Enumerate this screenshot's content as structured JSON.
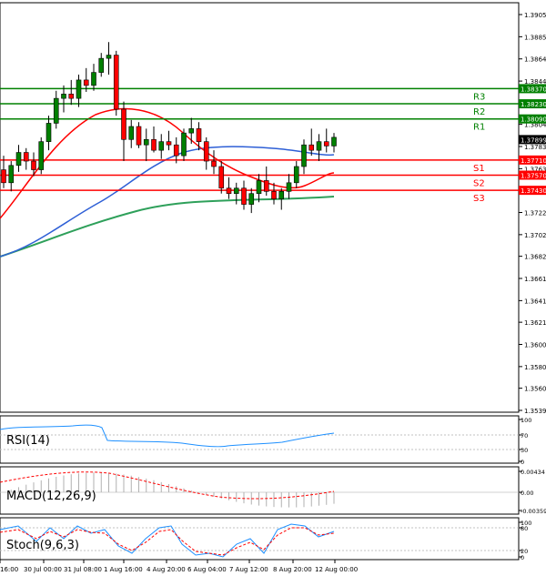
{
  "chart_data": {
    "type": "line",
    "price_axis": {
      "ticks": [
        "1.39055",
        "1.38850",
        "1.38645",
        "1.38440",
        "1.38230",
        "1.38040",
        "1.37835",
        "1.37630",
        "1.37225",
        "1.37020",
        "1.36820",
        "1.36615",
        "1.36410",
        "1.36210",
        "1.36005",
        "1.35800",
        "1.35600",
        "1.35395"
      ]
    },
    "levels": [
      {
        "label": "R3",
        "value": 1.3837,
        "price_text": "1.38370",
        "color": "#008000"
      },
      {
        "label": "R2",
        "value": 1.3823,
        "price_text": "1.38230",
        "color": "#008000"
      },
      {
        "label": "R1",
        "value": 1.3809,
        "price_text": "1.38090",
        "color": "#008000"
      },
      {
        "label": "S1",
        "value": 1.3771,
        "price_text": "1.37710",
        "color": "#ff0000"
      },
      {
        "label": "S2",
        "value": 1.3757,
        "price_text": "1.37570",
        "color": "#ff0000"
      },
      {
        "label": "S3",
        "value": 1.3743,
        "price_text": "1.37430",
        "color": "#ff0000"
      }
    ],
    "current_price": {
      "value": 1.37899,
      "text": "1.37899"
    },
    "x_axis": {
      "ticks": [
        "16:00",
        "30 Jul 00:00",
        "31 Jul 08:00",
        "1 Aug 16:00",
        "4 Aug 20:00",
        "6 Aug 04:00",
        "7 Aug 12:00",
        "8 Aug 20:00",
        "12 Aug 00:00"
      ]
    },
    "candles": [
      [
        1.3762,
        1.3775,
        1.3745,
        1.375
      ],
      [
        1.375,
        1.377,
        1.3742,
        1.3766
      ],
      [
        1.3766,
        1.3785,
        1.376,
        1.3778
      ],
      [
        1.3778,
        1.3782,
        1.3762,
        1.377
      ],
      [
        1.377,
        1.3778,
        1.3756,
        1.3762
      ],
      [
        1.3762,
        1.3792,
        1.3758,
        1.3788
      ],
      [
        1.3788,
        1.3812,
        1.378,
        1.3805
      ],
      [
        1.3805,
        1.3835,
        1.38,
        1.3828
      ],
      [
        1.3828,
        1.384,
        1.3815,
        1.3832
      ],
      [
        1.3832,
        1.3845,
        1.3822,
        1.3828
      ],
      [
        1.3828,
        1.385,
        1.382,
        1.3845
      ],
      [
        1.3845,
        1.3856,
        1.3834,
        1.384
      ],
      [
        1.384,
        1.386,
        1.3835,
        1.3852
      ],
      [
        1.3852,
        1.387,
        1.3848,
        1.3865
      ],
      [
        1.3865,
        1.388,
        1.385,
        1.3868
      ],
      [
        1.3868,
        1.3872,
        1.3812,
        1.3818
      ],
      [
        1.3818,
        1.3825,
        1.377,
        1.379
      ],
      [
        1.379,
        1.3808,
        1.3782,
        1.3802
      ],
      [
        1.3802,
        1.3806,
        1.3782,
        1.3785
      ],
      [
        1.3785,
        1.38,
        1.377,
        1.379
      ],
      [
        1.379,
        1.3802,
        1.3778,
        1.378
      ],
      [
        1.378,
        1.3795,
        1.3772,
        1.3788
      ],
      [
        1.3788,
        1.3798,
        1.378,
        1.3785
      ],
      [
        1.3785,
        1.3792,
        1.3768,
        1.3775
      ],
      [
        1.3775,
        1.38,
        1.377,
        1.3796
      ],
      [
        1.3796,
        1.381,
        1.3786,
        1.38
      ],
      [
        1.38,
        1.3806,
        1.378,
        1.3788
      ],
      [
        1.3788,
        1.3792,
        1.3762,
        1.377
      ],
      [
        1.377,
        1.378,
        1.3758,
        1.3765
      ],
      [
        1.3765,
        1.377,
        1.374,
        1.3745
      ],
      [
        1.3745,
        1.3755,
        1.3735,
        1.374
      ],
      [
        1.374,
        1.375,
        1.373,
        1.3745
      ],
      [
        1.3745,
        1.3752,
        1.3725,
        1.373
      ],
      [
        1.373,
        1.3745,
        1.3722,
        1.374
      ],
      [
        1.374,
        1.3758,
        1.3732,
        1.3752
      ],
      [
        1.3752,
        1.3765,
        1.3738,
        1.3742
      ],
      [
        1.3742,
        1.375,
        1.373,
        1.3735
      ],
      [
        1.3735,
        1.3745,
        1.3725,
        1.3742
      ],
      [
        1.3742,
        1.3758,
        1.3735,
        1.375
      ],
      [
        1.375,
        1.377,
        1.3745,
        1.3765
      ],
      [
        1.3765,
        1.379,
        1.3758,
        1.3785
      ],
      [
        1.3785,
        1.38,
        1.3775,
        1.378
      ],
      [
        1.378,
        1.3795,
        1.377,
        1.3788
      ],
      [
        1.3788,
        1.38,
        1.3778,
        1.3784
      ],
      [
        1.3784,
        1.3796,
        1.3778,
        1.3792
      ]
    ],
    "indicators": [
      {
        "name": "RSI(14)",
        "ticks": [
          "100",
          "70",
          "30",
          "0"
        ]
      },
      {
        "name": "MACD(12,26,9)",
        "ticks": [
          "0.00434",
          "0.00",
          "-0.003597"
        ]
      },
      {
        "name": "Stoch(9,6,3)",
        "ticks": [
          "100",
          "80",
          "20",
          "0"
        ]
      }
    ],
    "colors": {
      "candle_up": "#008000",
      "candle_down": "#ff0000",
      "ma_fast": "#ff0000",
      "ma_mid": "#2e5fd6",
      "ma_slow": "#2ea05a",
      "rsi": "#1e90ff",
      "macd_hist": "#b0b0b0",
      "macd_signal": "#ff0000",
      "stoch_main": "#1e90ff",
      "stoch_signal": "#ff0000",
      "level_green": "#008000",
      "level_red": "#ff0000"
    }
  }
}
